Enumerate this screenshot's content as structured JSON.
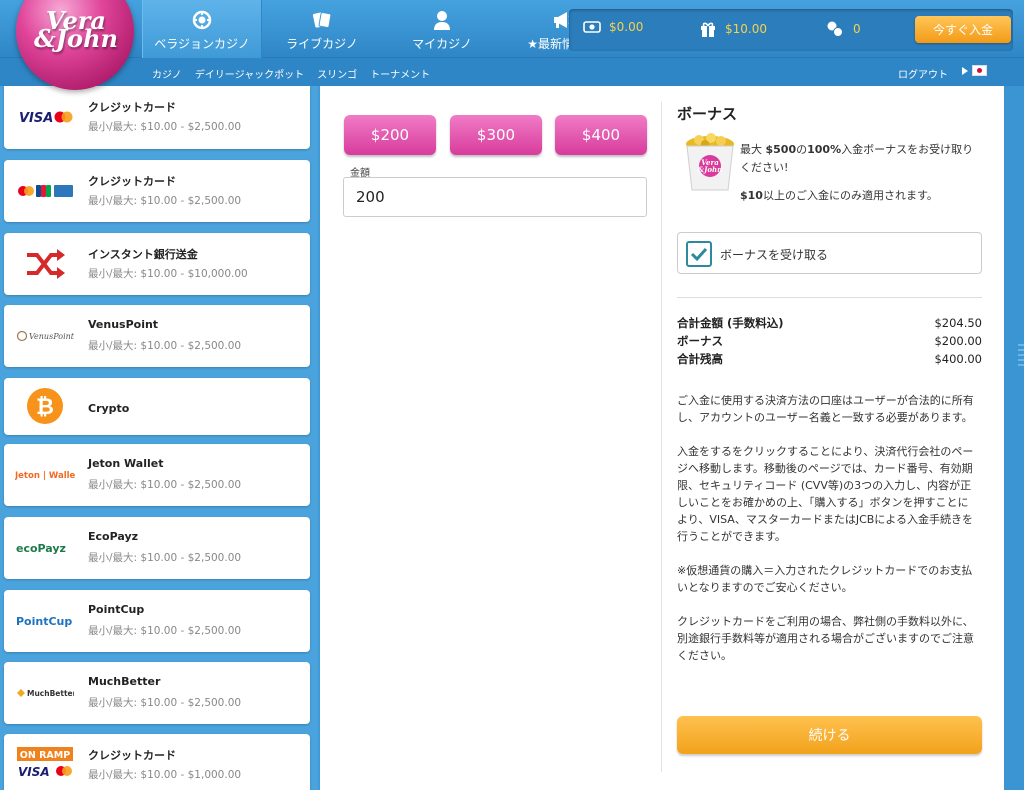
{
  "logo": {
    "text": "Vera\n&John"
  },
  "nav": {
    "tabs": [
      {
        "label": "ベラジョンカジノ",
        "icon": "chip-icon",
        "active": true
      },
      {
        "label": "ライブカジノ",
        "icon": "cards-icon",
        "active": false
      },
      {
        "label": "マイカジノ",
        "icon": "user-icon",
        "active": false
      },
      {
        "label": "★最新情報★",
        "icon": "megaphone-icon",
        "active": false
      }
    ],
    "sub": [
      "カジノ",
      "デイリージャックポット",
      "スリンゴ",
      "トーナメント"
    ],
    "logout": "ログアウト"
  },
  "wallet": {
    "cash": "$0.00",
    "bonus": "$10.00",
    "spins": "0",
    "deposit_label": "今すぐ入金"
  },
  "methods": [
    {
      "name": "クレジットカード",
      "limit": "最小/最大: $10.00 - $2,500.00",
      "logo": "visa-mastercard"
    },
    {
      "name": "クレジットカード",
      "limit": "最小/最大: $10.00 - $2,500.00",
      "logo": "mastercard-jcb-amex"
    },
    {
      "name": "インスタント銀行送金",
      "limit": "最小/最大: $10.00 - $10,000.00",
      "logo": "shuffle"
    },
    {
      "name": "VenusPoint",
      "limit": "最小/最大: $10.00 - $2,500.00",
      "logo": "venuspoint",
      "logo_text": "VenusPoint"
    },
    {
      "name": "Crypto",
      "limit": "",
      "logo": "bitcoin"
    },
    {
      "name": "Jeton Wallet",
      "limit": "最小/最大: $10.00 - $2,500.00",
      "logo": "jeton",
      "logo_text": "Jeton | Wallet"
    },
    {
      "name": "EcoPayz",
      "limit": "最小/最大: $10.00 - $2,500.00",
      "logo": "ecopayz",
      "logo_text": "ecoPayz"
    },
    {
      "name": "PointCup",
      "limit": "最小/最大: $10.00 - $2,500.00",
      "logo": "pointcup",
      "logo_text": "PointCup"
    },
    {
      "name": "MuchBetter",
      "limit": "最小/最大: $10.00 - $2,500.00",
      "logo": "muchbetter",
      "logo_text": "MuchBetter"
    },
    {
      "name": "クレジットカード",
      "limit": "最小/最大: $10.00 - $1,000.00",
      "logo": "onramp-visa",
      "logo_text": "ON RAMP"
    }
  ],
  "amount": {
    "presets": [
      "$200",
      "$300",
      "$400"
    ],
    "label": "金額",
    "value": "200"
  },
  "bonus": {
    "title": "ボーナス",
    "line1_pre": "最大 ",
    "line1_amount": "$500",
    "line1_mid": "の",
    "line1_pct": "100%",
    "line1_post": "入金ボーナスをお受け取りください!",
    "note_amount": "$10",
    "note_post": "以上のご入金にのみ適用されます。",
    "checkbox_label": "ボーナスを受け取る",
    "checked": true
  },
  "totals": [
    {
      "label": "合計金額 (手数料込)",
      "value": "$204.50"
    },
    {
      "label": "ボーナス",
      "value": "$200.00"
    },
    {
      "label": "合計残高",
      "value": "$400.00"
    }
  ],
  "info": [
    "ご入金に使用する決済方法の口座はユーザーが合法的に所有し、アカウントのユーザー名義と一致する必要があります。",
    "入金をするをクリックすることにより、決済代行会社のページへ移動します。移動後のページでは、カード番号、有効期限、セキュリティコード (CVV等)の3つの入力し、内容が正しいことをお確かめの上、「購入する」ボタンを押すことにより、VISA、マスターカードまたはJCBによる入金手続きを行うことができます。",
    "※仮想通貨の購入＝入力されたクレジットカードでのお支払いとなりますのでご安心ください。",
    "クレジットカードをご利用の場合、弊社側の手数料以外に、別途銀行手数料等が適用される場合がございますのでご注意ください。"
  ],
  "continue_label": "続ける",
  "colors": {
    "accent_pink": "#d83b9c",
    "accent_orange": "#f39a16",
    "header_blue": "#2f86c6"
  }
}
